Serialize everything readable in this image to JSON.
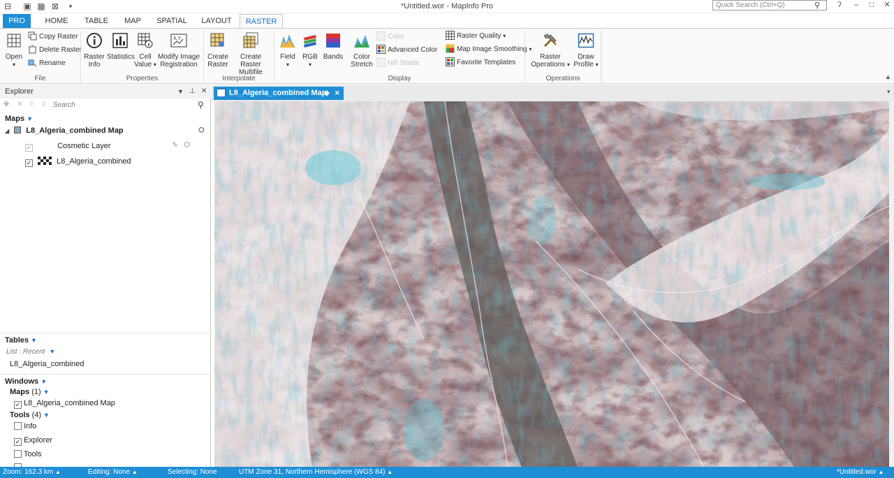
{
  "window": {
    "title": "*Untitled.wor - MapInfo Pro",
    "search_placeholder": "Quick Search (Ctrl+Q)"
  },
  "tabs": [
    "PRO",
    "HOME",
    "TABLE",
    "MAP",
    "SPATIAL",
    "LAYOUT",
    "RASTER"
  ],
  "ribbon": {
    "file": {
      "open": "Open",
      "copy": "Copy Raster",
      "delete": "Delete Raster",
      "rename": "Rename",
      "label": "File"
    },
    "properties": {
      "raster_info_1": "Raster",
      "raster_info_2": "Info",
      "statistics": "Statistics",
      "cell_1": "Cell",
      "cell_2": "Value",
      "modify_1": "Modify Image",
      "modify_2": "Registration",
      "label": "Properties"
    },
    "interpolate": {
      "create_1": "Create",
      "create_2": "Raster",
      "multi_1": "Create Raster",
      "multi_2": "Multifile",
      "label": "Interpolate"
    },
    "display": {
      "field": "Field",
      "rgb": "RGB",
      "bands": "Bands",
      "stretch_1": "Color",
      "stretch_2": "Stretch",
      "color": "Color",
      "advanced": "Advanced Color",
      "hillshade": "Hill Shade",
      "quality": "Raster Quality",
      "smoothing": "Map Image Smoothing",
      "templates": "Favorite Templates",
      "label": "Display"
    },
    "operations": {
      "raster_1": "Raster",
      "raster_2": "Operations",
      "profile_1": "Draw",
      "profile_2": "Profile",
      "label": "Operations"
    }
  },
  "explorer": {
    "title": "Explorer",
    "search_placeholder": "Search",
    "maps_header": "Maps",
    "map_name": "L8_Algeria_combined Map",
    "layers": [
      "Cosmetic Layer",
      "L8_Algeria_combined"
    ],
    "tables_header": "Tables",
    "list_recent": "List : Recent",
    "table_item": "L8_Algeria_combined",
    "windows_header": "Windows",
    "maps_sub": "Maps",
    "maps_count": "(1)",
    "map_window": "L8_Algeria_combined Map",
    "tools_sub": "Tools",
    "tools_count": "(4)",
    "tools": [
      "Info",
      "Explorer",
      "Tools"
    ]
  },
  "map_window": {
    "tab_title": "L8_Algeria_combined Map"
  },
  "status": {
    "zoom": "Zoom: 162.3 km",
    "editing": "Editing: None",
    "selecting": "Selecting: None",
    "projection": "UTM Zone 31, Northern Hemisphere (WGS 84)",
    "workspace": "*Untitled.wor"
  },
  "colors": {
    "accent": "#1e8fd6",
    "ribbon_bg": "#fafafa",
    "tab_active_text": "#1e73c6"
  }
}
